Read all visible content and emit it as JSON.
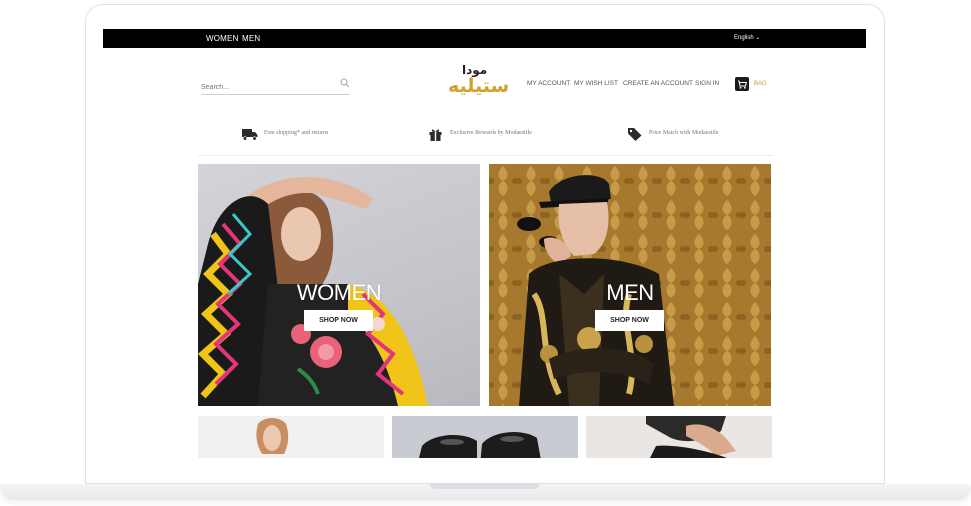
{
  "topbar": {
    "nav": [
      "WOMEN",
      "MEN"
    ],
    "language": "English ⌄"
  },
  "header": {
    "search_placeholder": "Search...",
    "logo_text_top": "مودا",
    "logo_text_main": "ستيليه",
    "links": [
      "MY ACCOUNT",
      "MY WISH LIST",
      "CREATE AN ACCOUNT",
      "SIGN IN"
    ],
    "cart_label": "BAG"
  },
  "benefits": [
    {
      "icon": "truck-icon",
      "text": "Free shipping* and returns"
    },
    {
      "icon": "gift-icon",
      "text": "Exclusive Rewards by Modaestile"
    },
    {
      "icon": "price-tag-icon",
      "text": "Price Match with Modaestile"
    }
  ],
  "heroes": [
    {
      "title": "WOMEN",
      "button": "SHOP NOW"
    },
    {
      "title": "MEN",
      "button": "SHOP NOW"
    }
  ],
  "colors": {
    "topbar": "#000000",
    "accent_gold": "#c9952e",
    "men_background": "#a4772d",
    "women_background": "#c9c8cf"
  }
}
